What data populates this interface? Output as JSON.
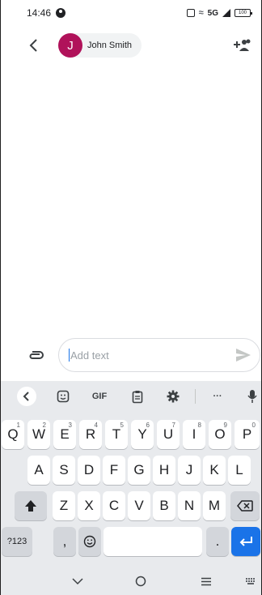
{
  "status_bar": {
    "time": "14:46",
    "network": "5G",
    "battery": "100"
  },
  "header": {
    "contact_initial": "J",
    "contact_name": "John Smith"
  },
  "compose": {
    "placeholder": "Add text"
  },
  "keyboard": {
    "toolbar": {
      "gif_label": "GIF",
      "more_label": "···"
    },
    "row1": [
      {
        "k": "Q",
        "n": "1"
      },
      {
        "k": "W",
        "n": "2"
      },
      {
        "k": "E",
        "n": "3"
      },
      {
        "k": "R",
        "n": "4"
      },
      {
        "k": "T",
        "n": "5"
      },
      {
        "k": "Y",
        "n": "6"
      },
      {
        "k": "U",
        "n": "7"
      },
      {
        "k": "I",
        "n": "8"
      },
      {
        "k": "O",
        "n": "9"
      },
      {
        "k": "P",
        "n": "0"
      }
    ],
    "row2": [
      "A",
      "S",
      "D",
      "F",
      "G",
      "H",
      "J",
      "K",
      "L"
    ],
    "row3": [
      "Z",
      "X",
      "C",
      "V",
      "B",
      "N",
      "M"
    ],
    "symbols_label": "?123",
    "comma_label": ",",
    "period_label": "."
  },
  "icons": {
    "back": "arrow-back-icon",
    "add_person": "person-add-icon",
    "attach": "attachment-icon",
    "send": "send-icon",
    "shift": "shift-icon",
    "backspace": "backspace-icon",
    "emoji": "emoji-icon",
    "enter": "enter-icon",
    "mic": "mic-icon"
  },
  "colors": {
    "avatar": "#b0125a",
    "accent": "#1a73e8",
    "keyboard_bg": "#e8eaed"
  }
}
